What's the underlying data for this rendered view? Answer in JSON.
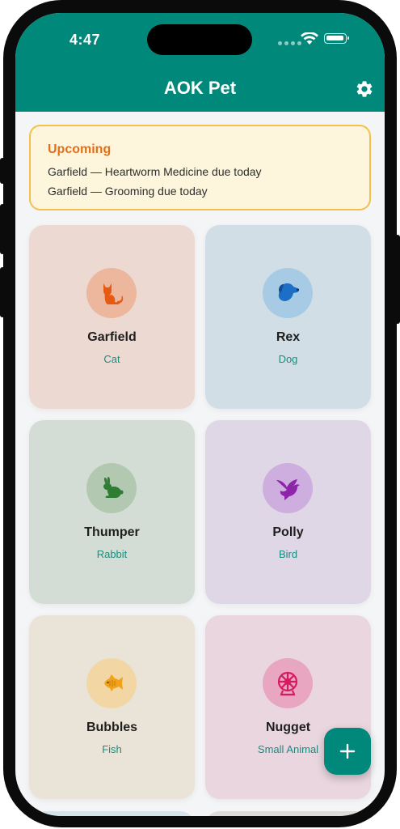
{
  "status_bar": {
    "time": "4:47"
  },
  "header": {
    "title": "AOK Pet",
    "settings_icon": "gear-icon"
  },
  "upcoming": {
    "title": "Upcoming",
    "items": [
      "Garfield — Heartworm Medicine due today",
      "Garfield — Grooming due today"
    ]
  },
  "pets": [
    {
      "name": "Garfield",
      "species": "Cat",
      "icon": "cat-icon",
      "card_color": "#ecd9d2",
      "avatar_color": "#ecb79d",
      "icon_color": "#e65a12"
    },
    {
      "name": "Rex",
      "species": "Dog",
      "icon": "dog-icon",
      "card_color": "#d1dee6",
      "avatar_color": "#a7cbe4",
      "icon_color": "#1d6fc5"
    },
    {
      "name": "Thumper",
      "species": "Rabbit",
      "icon": "rabbit-icon",
      "card_color": "#d4ddd5",
      "avatar_color": "#b2c8b1",
      "icon_color": "#2e7d32"
    },
    {
      "name": "Polly",
      "species": "Bird",
      "icon": "bird-icon",
      "card_color": "#dfd6e6",
      "avatar_color": "#cdaede",
      "icon_color": "#8e24aa"
    },
    {
      "name": "Bubbles",
      "species": "Fish",
      "icon": "fish-icon",
      "card_color": "#eae3d7",
      "avatar_color": "#f2d7a5",
      "icon_color": "#f0a21a"
    },
    {
      "name": "Nugget",
      "species": "Small Animal",
      "icon": "hamster-wheel-icon",
      "card_color": "#e9d6de",
      "avatar_color": "#e8a6c1",
      "icon_color": "#d81b60"
    }
  ],
  "fab": {
    "icon": "plus-icon"
  },
  "colors": {
    "primary": "#00897b",
    "upcoming_accent": "#e2701a",
    "upcoming_border": "#f2c14e"
  }
}
